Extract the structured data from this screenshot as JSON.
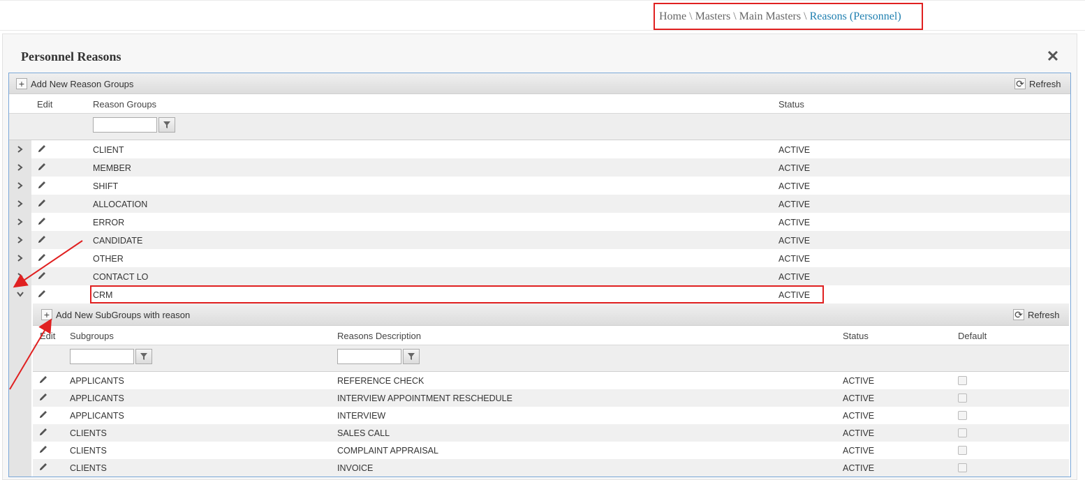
{
  "breadcrumb": {
    "items": [
      "Home",
      "Masters",
      "Main Masters"
    ],
    "current": "Reasons (Personnel)",
    "separator": "\\"
  },
  "panel": {
    "title": "Personnel Reasons",
    "close_icon": "close-icon"
  },
  "groups_grid": {
    "add_label": "Add New Reason Groups",
    "refresh_label": "Refresh",
    "columns": {
      "edit": "Edit",
      "reason_groups": "Reason Groups",
      "status": "Status"
    },
    "rows": [
      {
        "name": "CLIENT",
        "status": "ACTIVE"
      },
      {
        "name": "MEMBER",
        "status": "ACTIVE"
      },
      {
        "name": "SHIFT",
        "status": "ACTIVE"
      },
      {
        "name": "ALLOCATION",
        "status": "ACTIVE"
      },
      {
        "name": "ERROR",
        "status": "ACTIVE"
      },
      {
        "name": "CANDIDATE",
        "status": "ACTIVE"
      },
      {
        "name": "OTHER",
        "status": "ACTIVE"
      },
      {
        "name": "CONTACT LO",
        "status": "ACTIVE"
      },
      {
        "name": "CRM",
        "status": "ACTIVE",
        "expanded": true
      }
    ]
  },
  "subgroups_grid": {
    "add_label": "Add New SubGroups with reason",
    "refresh_label": "Refresh",
    "columns": {
      "edit": "Edit",
      "subgroups": "Subgroups",
      "reasons_description": "Reasons Description",
      "status": "Status",
      "default": "Default"
    },
    "rows": [
      {
        "subgroup": "APPLICANTS",
        "description": "REFERENCE CHECK",
        "status": "ACTIVE",
        "default": false
      },
      {
        "subgroup": "APPLICANTS",
        "description": "INTERVIEW APPOINTMENT RESCHEDULE",
        "status": "ACTIVE",
        "default": false
      },
      {
        "subgroup": "APPLICANTS",
        "description": "INTERVIEW",
        "status": "ACTIVE",
        "default": false
      },
      {
        "subgroup": "CLIENTS",
        "description": "SALES CALL",
        "status": "ACTIVE",
        "default": false
      },
      {
        "subgroup": "CLIENTS",
        "description": "COMPLAINT APPRAISAL",
        "status": "ACTIVE",
        "default": false
      },
      {
        "subgroup": "CLIENTS",
        "description": "INVOICE",
        "status": "ACTIVE",
        "default": false
      }
    ]
  },
  "colors": {
    "highlight": "#e02020",
    "link": "#1f7fb0",
    "grid_border": "#7aa7d8"
  }
}
